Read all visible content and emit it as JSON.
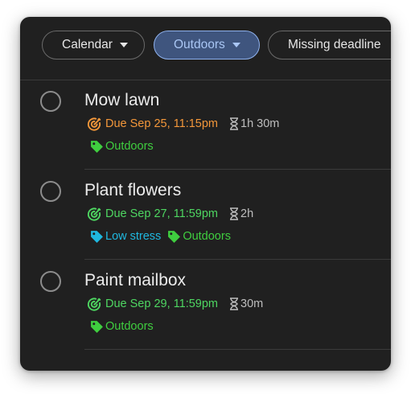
{
  "filters": [
    {
      "label": "Calendar",
      "active": false
    },
    {
      "label": "Outdoors",
      "active": true
    },
    {
      "label": "Missing deadline",
      "active": false
    }
  ],
  "tasks": [
    {
      "title": "Mow lawn",
      "due": "Due Sep 25, 11:15pm",
      "due_color": "#f3973a",
      "duration": "1h 30m",
      "tags": [
        {
          "label": "Outdoors",
          "color": "#3fce3f"
        }
      ]
    },
    {
      "title": "Plant flowers",
      "due": "Due Sep 27, 11:59pm",
      "due_color": "#4ed661",
      "duration": "2h",
      "tags": [
        {
          "label": "Low stress",
          "color": "#1fb8e0"
        },
        {
          "label": "Outdoors",
          "color": "#3fce3f"
        }
      ]
    },
    {
      "title": "Paint mailbox",
      "due": "Due Sep 29, 11:59pm",
      "due_color": "#4ed661",
      "duration": "30m",
      "tags": [
        {
          "label": "Outdoors",
          "color": "#3fce3f"
        }
      ]
    }
  ],
  "icons": {
    "filter_caret": "caret-down-icon",
    "complete": "circle-checkbox-icon",
    "due": "target-icon",
    "duration": "hourglass-icon",
    "tag": "tag-icon"
  }
}
